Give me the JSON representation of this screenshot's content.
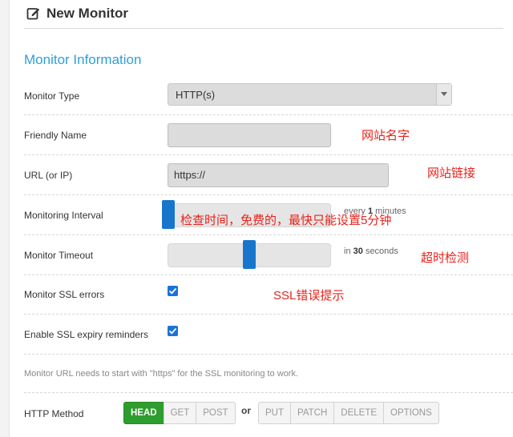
{
  "header": {
    "title": "New Monitor"
  },
  "section": {
    "title": "Monitor Information"
  },
  "fields": {
    "monitor_type": {
      "label": "Monitor Type",
      "value": "HTTP(s)"
    },
    "friendly_name": {
      "label": "Friendly Name",
      "value": ""
    },
    "url": {
      "label": "URL (or IP)",
      "value": "https://"
    },
    "interval": {
      "label": "Monitoring Interval",
      "note_prefix": "every",
      "value": "1",
      "unit": "minutes",
      "level": 0.0
    },
    "timeout": {
      "label": "Monitor Timeout",
      "note_prefix": "in",
      "value": "30",
      "unit": "seconds",
      "level": 0.5
    },
    "ssl_errors": {
      "label": "Monitor SSL errors",
      "checked": true
    },
    "ssl_expiry": {
      "label": "Enable SSL expiry reminders",
      "checked": true
    },
    "helper_text": "Monitor URL needs to start with \"https\" for the SSL monitoring to work.",
    "http_method": {
      "label": "HTTP Method",
      "group1": [
        "HEAD",
        "GET",
        "POST"
      ],
      "or": "or",
      "group2": [
        "PUT",
        "PATCH",
        "DELETE",
        "OPTIONS"
      ],
      "selected": "HEAD"
    }
  },
  "annotations": {
    "name": "网站名字",
    "url": "网站链接",
    "interval": "检查时间，免费的，最快只能设置5分钟",
    "timeout": "超时检测",
    "ssl": "SSL错误提示"
  },
  "colors": {
    "accent": "#2e9fd8",
    "handle": "#1776cc",
    "annotation": "#e8221b",
    "active_method": "#2e9d2e"
  }
}
